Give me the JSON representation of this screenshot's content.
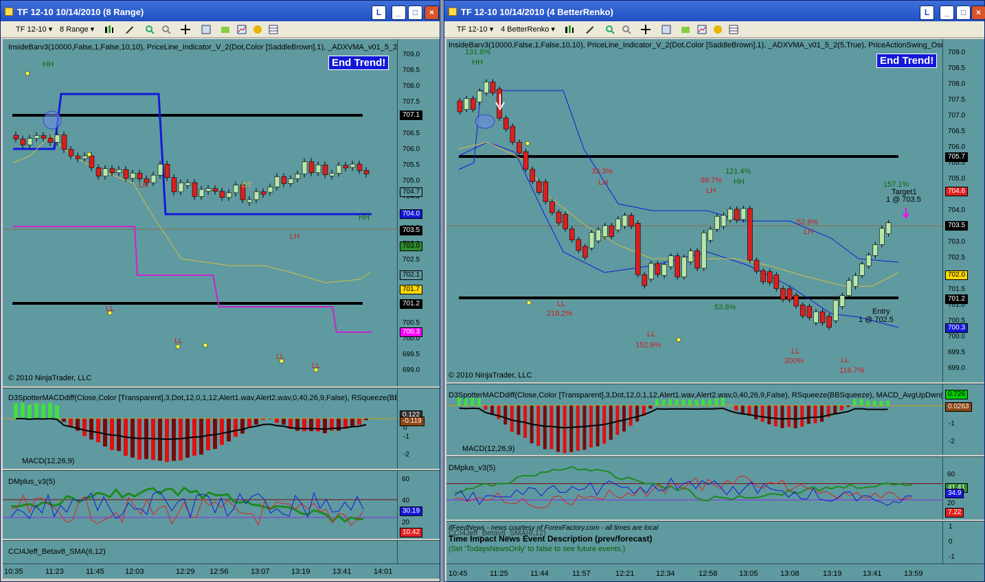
{
  "left": {
    "title": "TF 12-10  10/14/2010 (8 Range)",
    "toolbar": {
      "instrument": "TF 12-10",
      "interval": "8 Range"
    },
    "indicators_line": "InsideBarv3(10000,False,1,False,10,10), PriceLine_Indicator_V_2(Dot,Color [SaddleBrown],1), _ADXVMA_v01_5_2(5,True), Pric",
    "end_trend": "End Trend!",
    "copyright": "© 2010 NinjaTrader, LLC",
    "price_ticks": [
      "709.0",
      "708.5",
      "708.0",
      "707.5",
      "707.0",
      "706.5",
      "706.0",
      "705.5",
      "705.0",
      "704.5",
      "704.0",
      "703.5",
      "703.0",
      "702.5",
      "702.0",
      "701.5",
      "701.0",
      "700.5",
      "700.0",
      "699.5",
      "699.0"
    ],
    "price_tags": [
      {
        "text": "707.1",
        "bg": "#000000",
        "fg": "#ffffff"
      },
      {
        "text": "704.7",
        "bg": "#5f9aa0",
        "fg": "#000000"
      },
      {
        "text": "704.0",
        "bg": "#1418d8",
        "fg": "#ffffff"
      },
      {
        "text": "703.5",
        "bg": "#000000",
        "fg": "#ffffff"
      },
      {
        "text": "703.0",
        "bg": "#2e8b2e",
        "fg": "#000000"
      },
      {
        "text": "702.1",
        "bg": "#5f9aa0",
        "fg": "#000000"
      },
      {
        "text": "701.7",
        "bg": "#ffd700",
        "fg": "#000000"
      },
      {
        "text": "701.2",
        "bg": "#000000",
        "fg": "#ffffff"
      },
      {
        "text": "700.3",
        "bg": "#ff00ff",
        "fg": "#ffffff"
      }
    ],
    "annotations": [
      "HH",
      "LH",
      "DT",
      "LH",
      "HH",
      "LL",
      "LL",
      "LL",
      "LL"
    ],
    "macd_title": "D3SpotterMACDdiff(Close,Color [Transparent],3,Dot,12,0,1,12,Alert1.wav,Alert2.wav,0,40,26,9,False), RSqueeze(BBSqueeze), M",
    "macd_label": "MACD(12,26,9)",
    "macd_ticks": [
      "0",
      "-1",
      "-2"
    ],
    "macd_tags": [
      {
        "text": "0.122",
        "bg": "#333333",
        "fg": "#ffffff"
      },
      {
        "text": "-0.119",
        "bg": "#8b4513",
        "fg": "#ffffff"
      }
    ],
    "dm_title": "DMplus_v3(5)",
    "dm_ticks": [
      "60",
      "40",
      "20"
    ],
    "dm_tags": [
      {
        "text": "30.19",
        "bg": "#1418d8",
        "fg": "#ffffff"
      },
      {
        "text": "10.42",
        "bg": "#e02020",
        "fg": "#ffffff"
      }
    ],
    "cci_title": "CCI4Jeff_Betav8_SMA(6,12)",
    "time_ticks": [
      "10:35",
      "11:23",
      "11:45",
      "12:03",
      "12:29",
      "12:56",
      "13:07",
      "13:19",
      "13:41",
      "14:01"
    ]
  },
  "right": {
    "title": "TF 12-10  10/14/2010 (4 BetterRenko)",
    "toolbar": {
      "instrument": "TF 12-10",
      "interval": "4 BetterRenko"
    },
    "indicators_line": "InsideBarv3(10000,False,1,False,10,10), PriceLine_Indicator_V_2(Dot,Color [SaddleBrown],1), _ADXVMA_v01_5_2(5,True), PriceActionSwing_Osc(Standard,4,1",
    "end_trend": "End Trend!",
    "copyright": "© 2010 NinjaTrader, LLC",
    "price_ticks": [
      "709.0",
      "708.5",
      "708.0",
      "707.5",
      "707.0",
      "706.5",
      "706.0",
      "705.5",
      "705.0",
      "704.5",
      "704.0",
      "703.5",
      "703.0",
      "702.5",
      "702.0",
      "701.5",
      "701.0",
      "700.5",
      "700.0",
      "699.5",
      "699.0"
    ],
    "price_tags": [
      {
        "text": "705.7",
        "bg": "#000000",
        "fg": "#ffffff"
      },
      {
        "text": "704.6",
        "bg": "#e02020",
        "fg": "#ffffff"
      },
      {
        "text": "703.5",
        "bg": "#000000",
        "fg": "#ffffff"
      },
      {
        "text": "702.0",
        "bg": "#ffd700",
        "fg": "#000000"
      },
      {
        "text": "701.2",
        "bg": "#000000",
        "fg": "#ffffff"
      },
      {
        "text": "700.3",
        "bg": "#1418d8",
        "fg": "#ffffff"
      }
    ],
    "annotations": [
      "131.8%",
      "HH",
      "33.3%",
      "LH",
      "89.7%",
      "LH",
      "121.4%",
      "HH",
      "157.1%",
      "Target1",
      "1 @ 703.5",
      "52.9%",
      "LH",
      "219.2%",
      "LL",
      "53.8%",
      "152.6%",
      "LL",
      "200%",
      "LL",
      "116.7%",
      "LL",
      "Entry",
      "1 @ 702.5"
    ],
    "macd_title": "D3SpotterMACDdiff(Close,Color [Transparent],3,Dot,12,0,1,12,Alert1.wav,Alert2.wav,0,40,26,9,False), RSqueeze(BBSqueeze), MACD_AvgUpDwn(8",
    "macd_label": "MACD(12,26,9)",
    "macd_ticks": [
      "0",
      "-1",
      "-2"
    ],
    "macd_tags": [
      {
        "text": "0.726",
        "bg": "#00cc00",
        "fg": "#000000"
      },
      {
        "text": "0.0263",
        "bg": "#8b4513",
        "fg": "#ffffff"
      }
    ],
    "dm_title": "DMplus_v3(5)",
    "dm_ticks": [
      "60",
      "40",
      "20"
    ],
    "dm_tags": [
      {
        "text": "41.41",
        "bg": "#2e8b2e",
        "fg": "#ffffff"
      },
      {
        "text": "34.9",
        "bg": "#1418d8",
        "fg": "#ffffff"
      },
      {
        "text": "7.22",
        "bg": "#e02020",
        "fg": "#ffffff"
      }
    ],
    "cci_title": "CCI4Jeff_Betav8_SMA(6,12)",
    "cci_ticks": [
      "1",
      "0",
      "-1"
    ],
    "news": {
      "source": "ifFeedNews - news courtesy of ForexFactory.com - all times are local",
      "header": "Time     Impact     News Event Description (prev/forecast)",
      "hint": "(Set 'TodaysNewsOnly' to false to see future events.)"
    },
    "time_ticks": [
      "10:45",
      "11:25",
      "11:44",
      "11:57",
      "12:21",
      "12:34",
      "12:58",
      "13:05",
      "13:08",
      "13:19",
      "13:41",
      "13:59"
    ]
  }
}
